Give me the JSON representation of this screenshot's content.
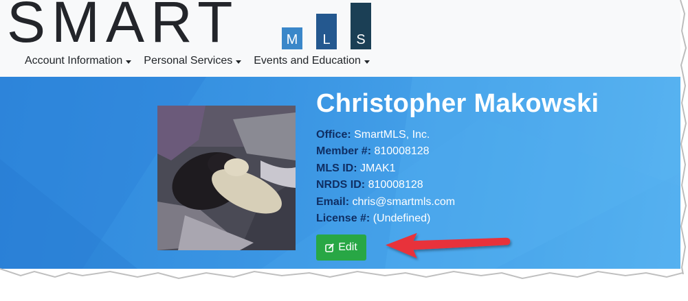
{
  "logo": {
    "word": "SMART",
    "mls_letters": [
      "M",
      "L",
      "S"
    ],
    "colors": [
      "#3a87c9",
      "#24588f",
      "#1b3f55"
    ]
  },
  "nav": {
    "items": [
      {
        "label": "Account Information"
      },
      {
        "label": "Personal Services"
      },
      {
        "label": "Events and Education"
      }
    ]
  },
  "profile": {
    "name": "Christopher Makowski",
    "fields": [
      {
        "label": "Office:",
        "value": "SmartMLS, Inc."
      },
      {
        "label": "Member #:",
        "value": "810008128"
      },
      {
        "label": "MLS ID:",
        "value": "JMAK1"
      },
      {
        "label": "NRDS ID:",
        "value": "810008128"
      },
      {
        "label": "Email:",
        "value": "chris@smartmls.com"
      },
      {
        "label": "License #:",
        "value": "(Undefined)"
      }
    ],
    "edit_label": "Edit",
    "edit_icon": "edit-icon"
  },
  "colors": {
    "hero": "#3a95e3",
    "label": "#0f2e63",
    "edit": "#28a745",
    "arrow": "#e8323b"
  }
}
